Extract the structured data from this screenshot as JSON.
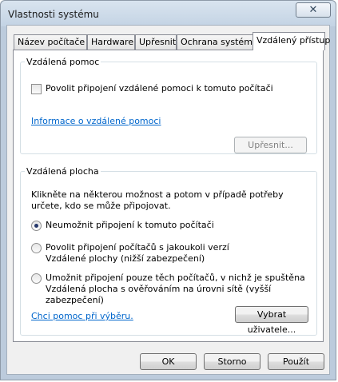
{
  "window": {
    "title": "Vlastnosti systému",
    "close_glyph": "✕"
  },
  "tabs": [
    {
      "label": "Název počítače",
      "active": false
    },
    {
      "label": "Hardware",
      "active": false
    },
    {
      "label": "Upřesnit",
      "active": false
    },
    {
      "label": "Ochrana systému",
      "active": false
    },
    {
      "label": "Vzdálený přístup",
      "active": true
    }
  ],
  "remote_assistance": {
    "title": "Vzdálená pomoc",
    "allow_checkbox_label": "Povolit připojení vzdálené pomoci k tomuto počítači",
    "allow_checked": false,
    "info_link": "Informace o vzdálené pomoci",
    "advanced_button": "Upřesnit..."
  },
  "remote_desktop": {
    "title": "Vzdálená plocha",
    "description": "Klikněte na některou možnost a potom v případě potřeby určete, kdo se může připojovat.",
    "options": [
      {
        "label": "Neumožnit připojení k tomuto počítači",
        "checked": true
      },
      {
        "label": "Povolit připojení počítačů s jakoukoli verzí Vzdálené plochy (nižší zabezpečení)",
        "checked": false
      },
      {
        "label": "Umožnit připojení pouze těch počítačů, v nichž je spuštěna Vzdálená plocha s ověřováním na úrovni sítě (vyšší zabezpečení)",
        "checked": false
      }
    ],
    "help_link": "Chci pomoc při výběru.",
    "select_users_button": "Vybrat uživatele..."
  },
  "footer": {
    "ok": "OK",
    "cancel": "Storno",
    "apply": "Použít"
  }
}
